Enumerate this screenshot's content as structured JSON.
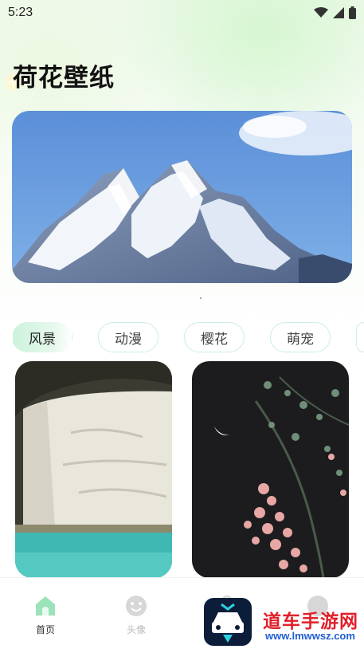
{
  "status_bar": {
    "time": "5:23"
  },
  "header": {
    "title": "荷花壁纸"
  },
  "categories": [
    {
      "label": "风景",
      "active": true
    },
    {
      "label": "动漫",
      "active": false
    },
    {
      "label": "樱花",
      "active": false
    },
    {
      "label": "萌宠",
      "active": false
    }
  ],
  "bottom_nav": [
    {
      "label": "首页",
      "icon": "home-icon",
      "active": true
    },
    {
      "label": "头像",
      "icon": "smiley-icon",
      "active": false
    },
    {
      "label": "",
      "icon": "bag-icon",
      "active": false
    },
    {
      "label": "",
      "icon": "profile-icon",
      "active": false
    }
  ],
  "watermark": {
    "text": "道车手游网",
    "url": "www.lmwwsz.com"
  },
  "colors": {
    "accent": "#7fd9a8",
    "tab_border": "#cdeedf"
  }
}
